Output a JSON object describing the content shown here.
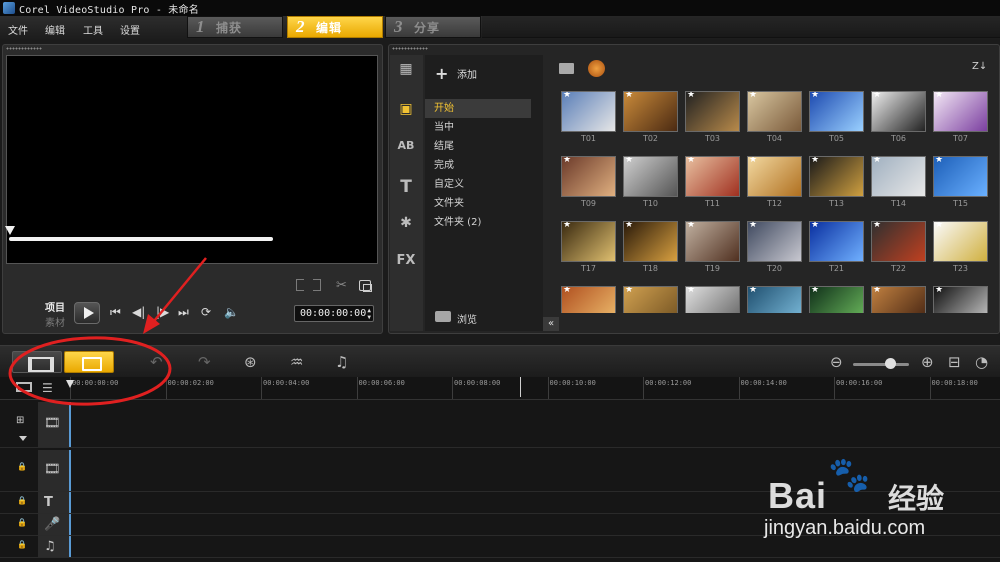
{
  "window": {
    "title": "Corel VideoStudio Pro - 未命名"
  },
  "menu": {
    "file": "文件",
    "edit": "编辑",
    "tools": "工具",
    "settings": "设置"
  },
  "steps": [
    {
      "num": "1",
      "label": "捕获",
      "active": false
    },
    {
      "num": "2",
      "label": "编辑",
      "active": true
    },
    {
      "num": "3",
      "label": "分享",
      "active": false
    }
  ],
  "preview": {
    "project_label": "项目",
    "clip_label": "素材",
    "timecode": "00:00:00:00"
  },
  "library": {
    "add_label": "添加",
    "categories": [
      "开始",
      "当中",
      "结尾",
      "完成",
      "自定义",
      "文件夹",
      "文件夹 (2)"
    ],
    "selected_category": "开始",
    "browse_label": "浏览",
    "thumbnails": [
      "T01",
      "T02",
      "T03",
      "T04",
      "T05",
      "T06",
      "T07",
      "T09",
      "T10",
      "T11",
      "T12",
      "T13",
      "T14",
      "T15",
      "T17",
      "T18",
      "T19",
      "T20",
      "T21",
      "T22",
      "T23",
      "",
      "",
      "",
      "",
      "",
      "",
      ""
    ]
  },
  "timeline": {
    "ruler_labels": [
      "00:00:00:00",
      "00:00:02:00",
      "00:00:04:00",
      "00:00:06:00",
      "00:00:08:00",
      "00:00:10:00",
      "00:00:12:00",
      "00:00:14:00",
      "00:00:16:00",
      "00:00:18:00"
    ]
  },
  "colors": {
    "accent": "#f1c233",
    "annotation": "#e02020",
    "background": "#1b1b1b"
  },
  "watermark": {
    "brand": "Bai",
    "brand_cn": "经验",
    "url": "jingyan.baidu.com"
  }
}
